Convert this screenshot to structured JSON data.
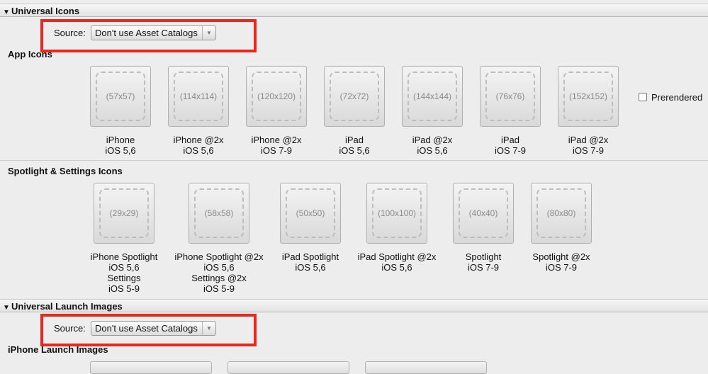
{
  "universal_icons": {
    "header": "Universal Icons",
    "source_label": "Source:",
    "source_value": "Don't use Asset Catalogs",
    "app_icons_title": "App Icons",
    "app_icons": [
      {
        "size": "(57x57)",
        "caption": "iPhone\niOS 5,6"
      },
      {
        "size": "(114x114)",
        "caption": "iPhone @2x\niOS 5,6"
      },
      {
        "size": "(120x120)",
        "caption": "iPhone @2x\niOS 7-9"
      },
      {
        "size": "(72x72)",
        "caption": "iPad\niOS 5,6"
      },
      {
        "size": "(144x144)",
        "caption": "iPad @2x\niOS 5,6"
      },
      {
        "size": "(76x76)",
        "caption": "iPad\niOS 7-9"
      },
      {
        "size": "(152x152)",
        "caption": "iPad @2x\niOS 7-9"
      }
    ],
    "prerendered_label": "Prerendered",
    "prerendered_checked": false,
    "spotlight_title": "Spotlight & Settings Icons",
    "spotlight_icons": [
      {
        "size": "(29x29)",
        "caption": "iPhone Spotlight\niOS 5,6\nSettings\niOS 5-9"
      },
      {
        "size": "(58x58)",
        "caption": "iPhone Spotlight @2x\niOS 5,6\nSettings @2x\niOS 5-9"
      },
      {
        "size": "(50x50)",
        "caption": "iPad Spotlight\niOS 5,6"
      },
      {
        "size": "(100x100)",
        "caption": "iPad Spotlight @2x\niOS 5,6"
      },
      {
        "size": "(40x40)",
        "caption": "Spotlight\niOS 7-9"
      },
      {
        "size": "(80x80)",
        "caption": "Spotlight @2x\niOS 7-9"
      }
    ]
  },
  "universal_launch": {
    "header": "Universal Launch Images",
    "source_label": "Source:",
    "source_value": "Don't use Asset Catalogs",
    "iphone_title": "iPhone Launch Images"
  },
  "colors": {
    "highlight": "#e8281d"
  }
}
